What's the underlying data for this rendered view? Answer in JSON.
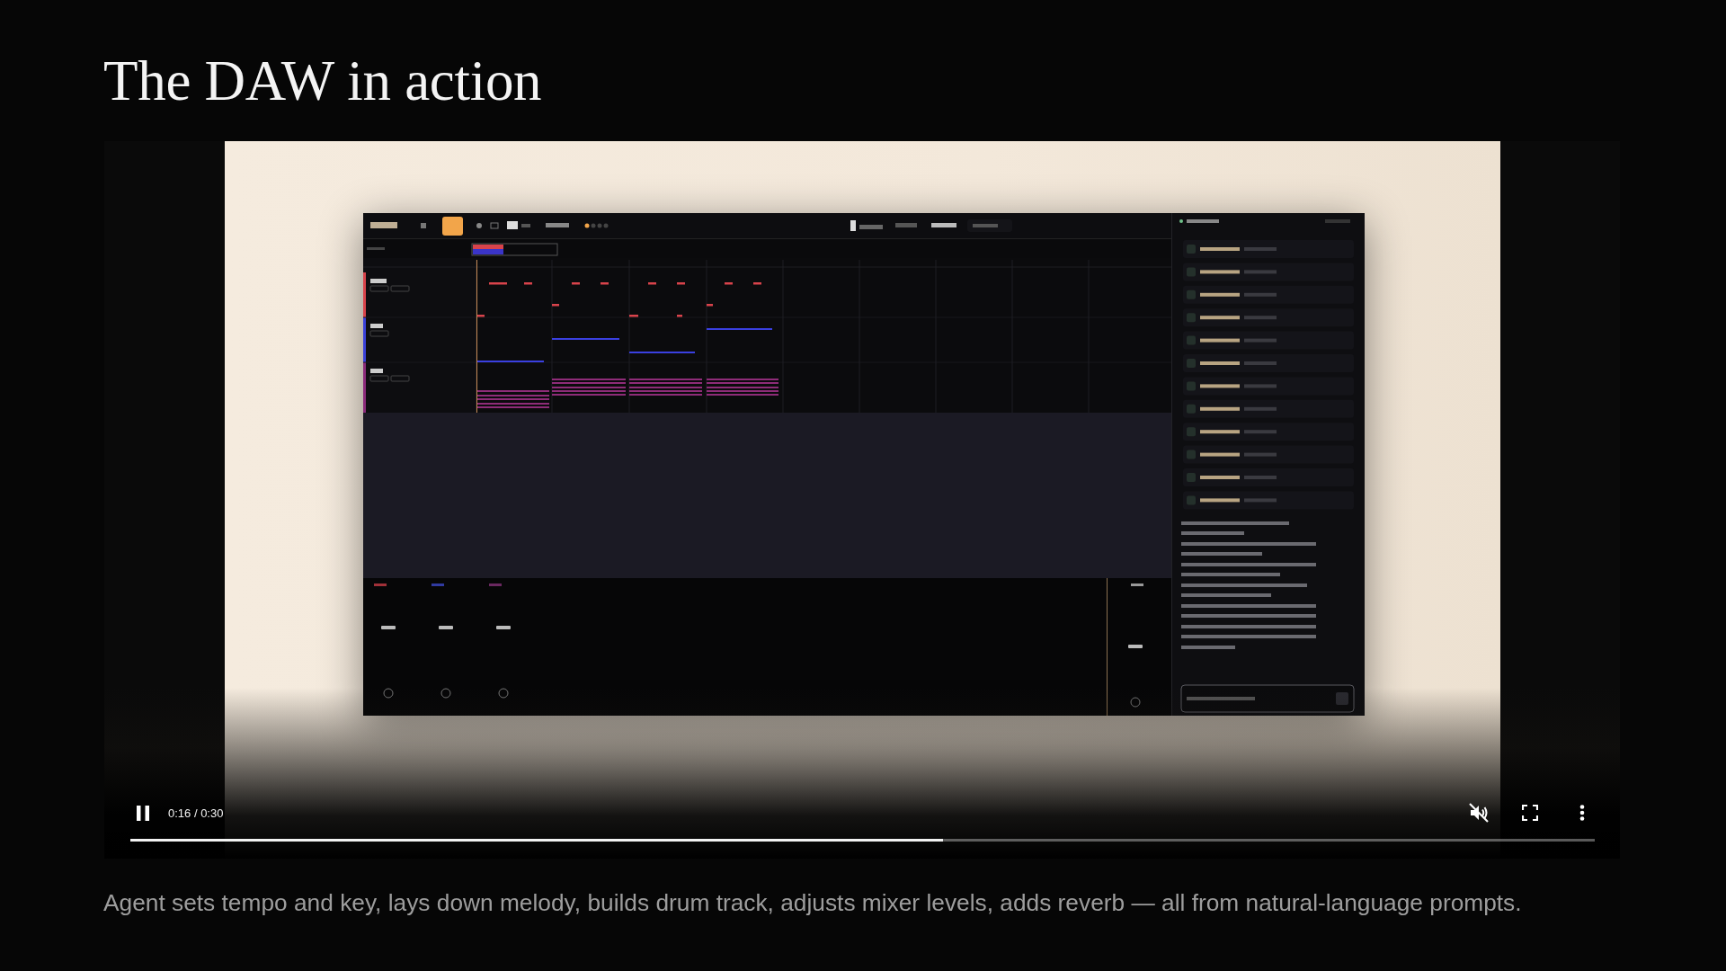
{
  "heading": "The DAW in action",
  "video_player": {
    "playing": true,
    "time": "0:16 / 0:30",
    "muted": true,
    "progress": {
      "level": 0.555
    }
  },
  "description": "Agent sets tempo and key, lays down melody, builds drum track, adjusts mixer levels, adds reverb — all from natural-language prompts."
}
